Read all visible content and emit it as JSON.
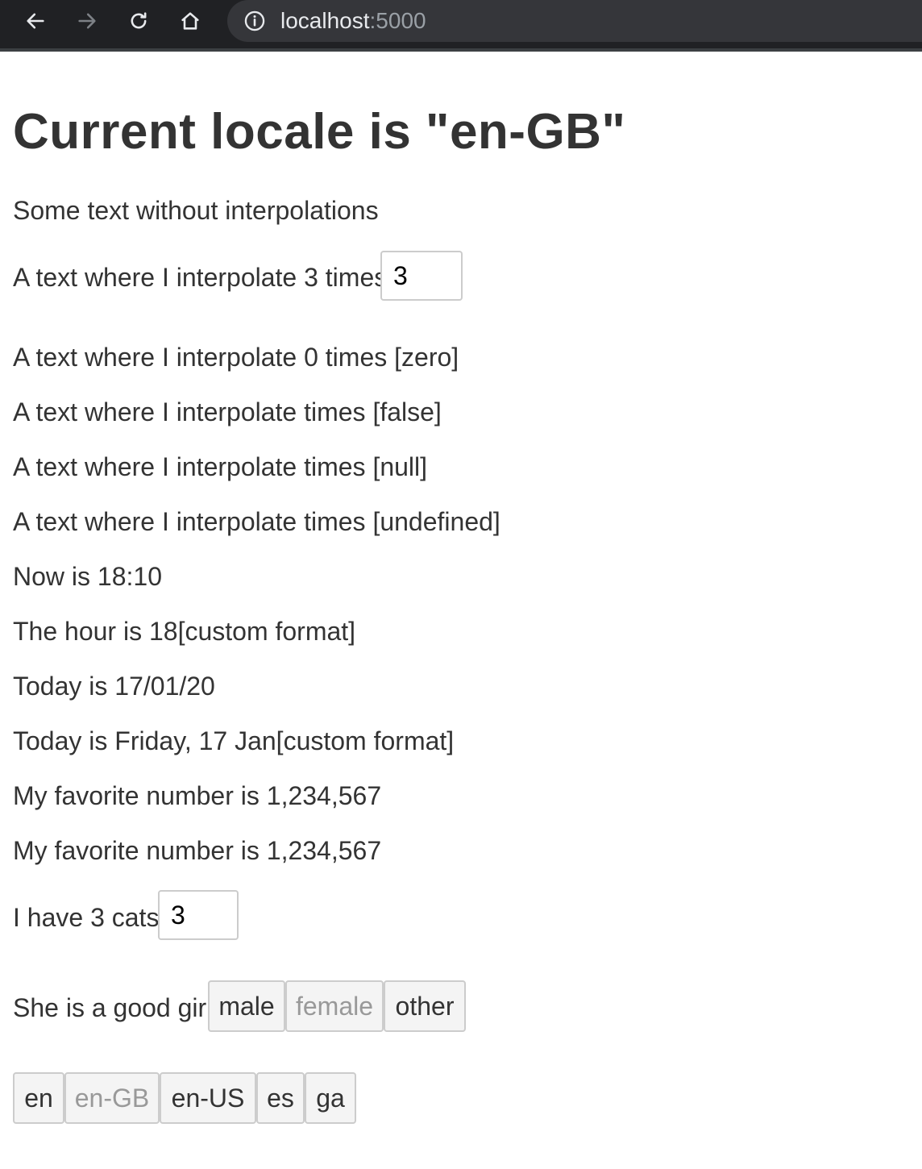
{
  "browser": {
    "url_host": "localhost",
    "url_port": ":5000"
  },
  "page": {
    "title": "Current locale is \"en-GB\"",
    "lines": {
      "no_interp": "Some text without interpolations",
      "interp_three": "A text where I interpolate 3 times",
      "interp_zero": "A text where I interpolate 0 times [zero]",
      "interp_false": "A text where I interpolate times [false]",
      "interp_null": "A text where I interpolate times [null]",
      "interp_undefined": "A text where I interpolate times [undefined]",
      "now": "Now is 18:10",
      "hour": "The hour is 18[custom format]",
      "today_short": "Today is 17/01/20",
      "today_long": "Today is Friday, 17 Jan[custom format]",
      "fav_number_1": "My favorite number is 1,234,567",
      "fav_number_2": "My favorite number is 1,234,567",
      "cats": "I have 3 cats",
      "gender": "She is a good girl"
    },
    "inputs": {
      "times_value": "3",
      "cats_value": "3"
    },
    "gender_buttons": {
      "male": "male",
      "female": "female",
      "other": "other",
      "selected": "female"
    },
    "locale_buttons": {
      "en": "en",
      "en_gb": "en-GB",
      "en_us": "en-US",
      "es": "es",
      "ga": "ga",
      "selected": "en-GB"
    }
  }
}
